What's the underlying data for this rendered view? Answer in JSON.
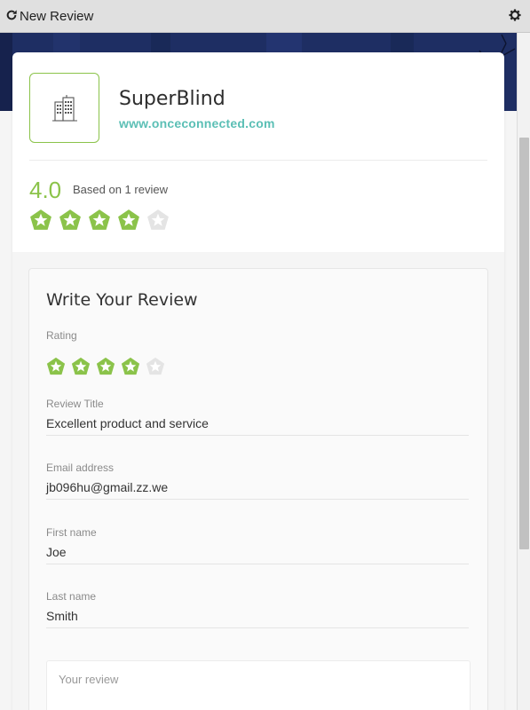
{
  "window": {
    "title": "New Review"
  },
  "business": {
    "name": "SuperBlind",
    "url": "www.onceconnected.com"
  },
  "rating_summary": {
    "score": "4.0",
    "based_on": "Based on 1 review",
    "stars_filled": 4,
    "stars_total": 5
  },
  "form": {
    "title": "Write Your Review",
    "rating_label": "Rating",
    "rating_value": 4,
    "review_title": {
      "label": "Review Title",
      "value": "Excellent product and service"
    },
    "email": {
      "label": "Email address",
      "value": "jb096hu@gmail.zz.we"
    },
    "first_name": {
      "label": "First name",
      "value": "Joe"
    },
    "last_name": {
      "label": "Last name",
      "value": "Smith"
    },
    "review_placeholder": "Your review"
  },
  "colors": {
    "accent": "#8bc34a",
    "link": "#5bbfb5",
    "hero": "#1e2e63",
    "star_empty": "#e4e4e4"
  },
  "icons": {
    "refresh": "refresh-icon",
    "settings": "gear-icon",
    "logo": "building-icon",
    "star": "star-icon"
  }
}
